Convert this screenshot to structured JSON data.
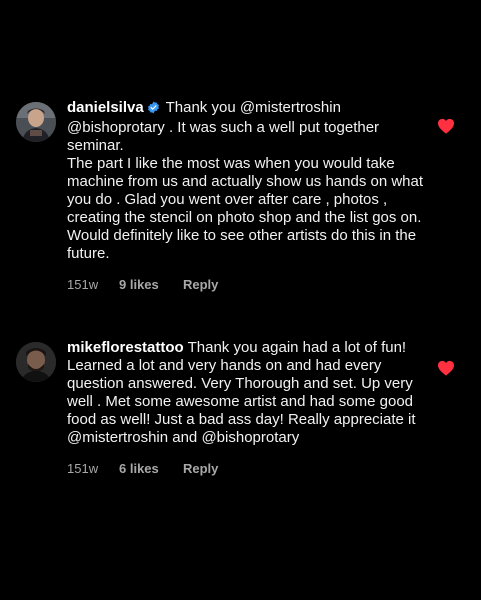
{
  "comments": [
    {
      "username": "danielsilva",
      "verified": true,
      "avatar_icon": "avatar-photo",
      "text_line1": " Thank you @mistertroshin @bishoprotary . It was such a well put together seminar.",
      "text_para2": "The part I like the most was when you would take machine from us and actually show us hands on what you do . Glad you went over after care , photos , creating the stencil on photo shop and the list gos on. Would definitely like to see other artists do this in the future.",
      "time": "151w",
      "likes": "9 likes",
      "reply": "Reply",
      "liked": true
    },
    {
      "username": "mikeflorestattoo",
      "verified": false,
      "avatar_icon": "avatar-photo",
      "text": " Thank you again had a lot of fun! Learned a lot and very hands on and had every question answered. Very Thorough and set. Up very well . Met some awesome artist and had some good food as well! Just a bad ass day! Really appreciate it @mistertroshin and @bishoprotary",
      "time": "151w",
      "likes": "6 likes",
      "reply": "Reply",
      "liked": true
    }
  ],
  "colors": {
    "background": "#000000",
    "text": "#f2f2f2",
    "meta": "#a8a8a8",
    "heart": "#ff3040",
    "verified": "#3897f0"
  }
}
